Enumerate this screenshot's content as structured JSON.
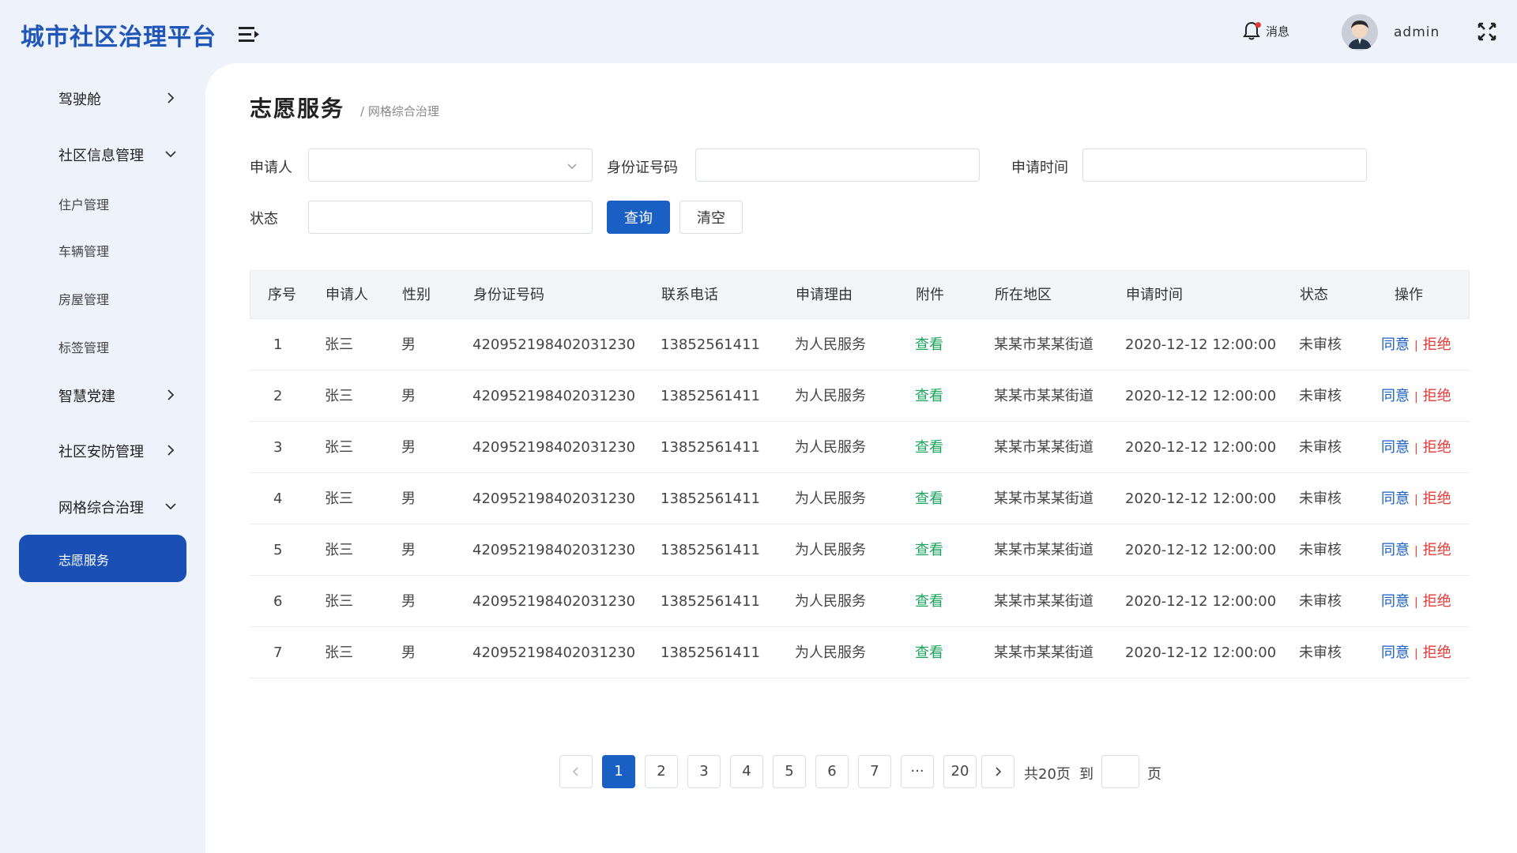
{
  "app": {
    "title": "城市社区治理平台"
  },
  "header": {
    "message_label": "消息",
    "username": "admin"
  },
  "sidebar": {
    "items": [
      {
        "label": "驾驶舱"
      },
      {
        "label": "社区信息管理"
      },
      {
        "label": "住户管理"
      },
      {
        "label": "车辆管理"
      },
      {
        "label": "房屋管理"
      },
      {
        "label": "标签管理"
      },
      {
        "label": "智慧党建"
      },
      {
        "label": "社区安防管理"
      },
      {
        "label": "网格综合治理"
      },
      {
        "label": "志愿服务"
      }
    ]
  },
  "page": {
    "title": "志愿服务",
    "breadcrumb": "/ 网格综合治理"
  },
  "filters": {
    "applicant_label": "申请人",
    "applicant_value": "",
    "idcard_label": "身份证号码",
    "idcard_value": "",
    "time_label": "申请时间",
    "time_value": "",
    "status_label": "状态",
    "status_value": "",
    "query_button": "查询",
    "clear_button": "清空"
  },
  "table": {
    "headers": [
      "序号",
      "申请人",
      "性别",
      "身份证号码",
      "联系电话",
      "申请理由",
      "附件",
      "所在地区",
      "申请时间",
      "状态",
      "操作"
    ],
    "rows": [
      {
        "no": "1",
        "name": "张三",
        "gender": "男",
        "idcard": "420952198402031230",
        "phone": "13852561411",
        "reason": "为人民服务",
        "attach": "查看",
        "area": "某某市某某街道",
        "time": "2020-12-12 12:00:00",
        "status": "未审核",
        "agree": "同意",
        "reject": "拒绝"
      },
      {
        "no": "2",
        "name": "张三",
        "gender": "男",
        "idcard": "420952198402031230",
        "phone": "13852561411",
        "reason": "为人民服务",
        "attach": "查看",
        "area": "某某市某某街道",
        "time": "2020-12-12 12:00:00",
        "status": "未审核",
        "agree": "同意",
        "reject": "拒绝"
      },
      {
        "no": "3",
        "name": "张三",
        "gender": "男",
        "idcard": "420952198402031230",
        "phone": "13852561411",
        "reason": "为人民服务",
        "attach": "查看",
        "area": "某某市某某街道",
        "time": "2020-12-12 12:00:00",
        "status": "未审核",
        "agree": "同意",
        "reject": "拒绝"
      },
      {
        "no": "4",
        "name": "张三",
        "gender": "男",
        "idcard": "420952198402031230",
        "phone": "13852561411",
        "reason": "为人民服务",
        "attach": "查看",
        "area": "某某市某某街道",
        "time": "2020-12-12 12:00:00",
        "status": "未审核",
        "agree": "同意",
        "reject": "拒绝"
      },
      {
        "no": "5",
        "name": "张三",
        "gender": "男",
        "idcard": "420952198402031230",
        "phone": "13852561411",
        "reason": "为人民服务",
        "attach": "查看",
        "area": "某某市某某街道",
        "time": "2020-12-12 12:00:00",
        "status": "未审核",
        "agree": "同意",
        "reject": "拒绝"
      },
      {
        "no": "6",
        "name": "张三",
        "gender": "男",
        "idcard": "420952198402031230",
        "phone": "13852561411",
        "reason": "为人民服务",
        "attach": "查看",
        "area": "某某市某某街道",
        "time": "2020-12-12 12:00:00",
        "status": "未审核",
        "agree": "同意",
        "reject": "拒绝"
      },
      {
        "no": "7",
        "name": "张三",
        "gender": "男",
        "idcard": "420952198402031230",
        "phone": "13852561411",
        "reason": "为人民服务",
        "attach": "查看",
        "area": "某某市某某街道",
        "time": "2020-12-12 12:00:00",
        "status": "未审核",
        "agree": "同意",
        "reject": "拒绝"
      }
    ]
  },
  "pagination": {
    "pages": [
      "1",
      "2",
      "3",
      "4",
      "5",
      "6",
      "7",
      "···",
      "20"
    ],
    "current": "1",
    "total_text": "共20页",
    "goto_label": "到",
    "page_unit": "页",
    "goto_value": ""
  },
  "colors": {
    "brand": "#1f56b8",
    "primary": "#1a5fc4",
    "view": "#1aa45c",
    "reject": "#e53935"
  },
  "icons": [
    "menu-fold-icon",
    "bell-icon",
    "avatar",
    "fullscreen-icon",
    "chevron-right-icon",
    "chevron-down-icon",
    "chevron-left-icon"
  ]
}
